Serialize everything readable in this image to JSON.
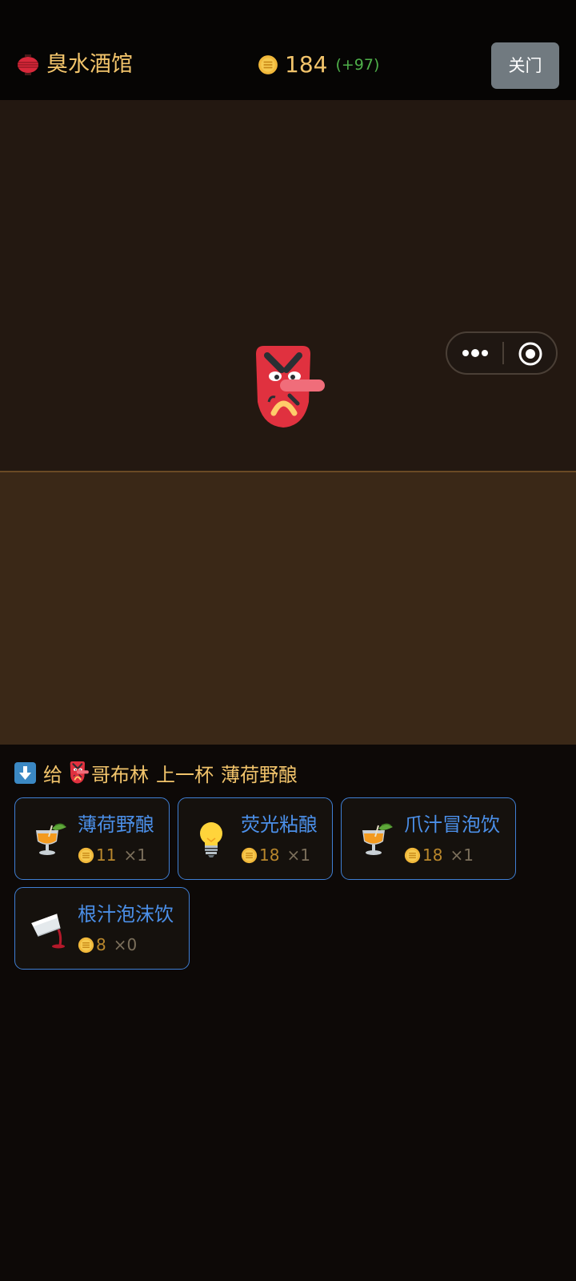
{
  "header": {
    "tavern_name": "臭水酒馆",
    "coins": "184",
    "coins_delta": "(+97)",
    "close_label": "关门"
  },
  "order": {
    "prefix": "给",
    "customer": "哥布林",
    "verb": "上一杯",
    "drink": "薄荷野酿"
  },
  "drinks": [
    {
      "name": "薄荷野酿",
      "price": "11",
      "qty": "×1",
      "icon": "tropical-drink-icon"
    },
    {
      "name": "荧光粘酿",
      "price": "18",
      "qty": "×1",
      "icon": "light-bulb-icon"
    },
    {
      "name": "爪汁冒泡饮",
      "price": "18",
      "qty": "×1",
      "icon": "tropical-drink-icon"
    },
    {
      "name": "根汁泡沫饮",
      "price": "8",
      "qty": "×0",
      "icon": "pouring-glass-icon"
    }
  ],
  "colors": {
    "gold": "#f2c46b",
    "delta_green": "#4fb04a",
    "card_border": "#3f7fd4",
    "card_title": "#4b8fe8"
  }
}
